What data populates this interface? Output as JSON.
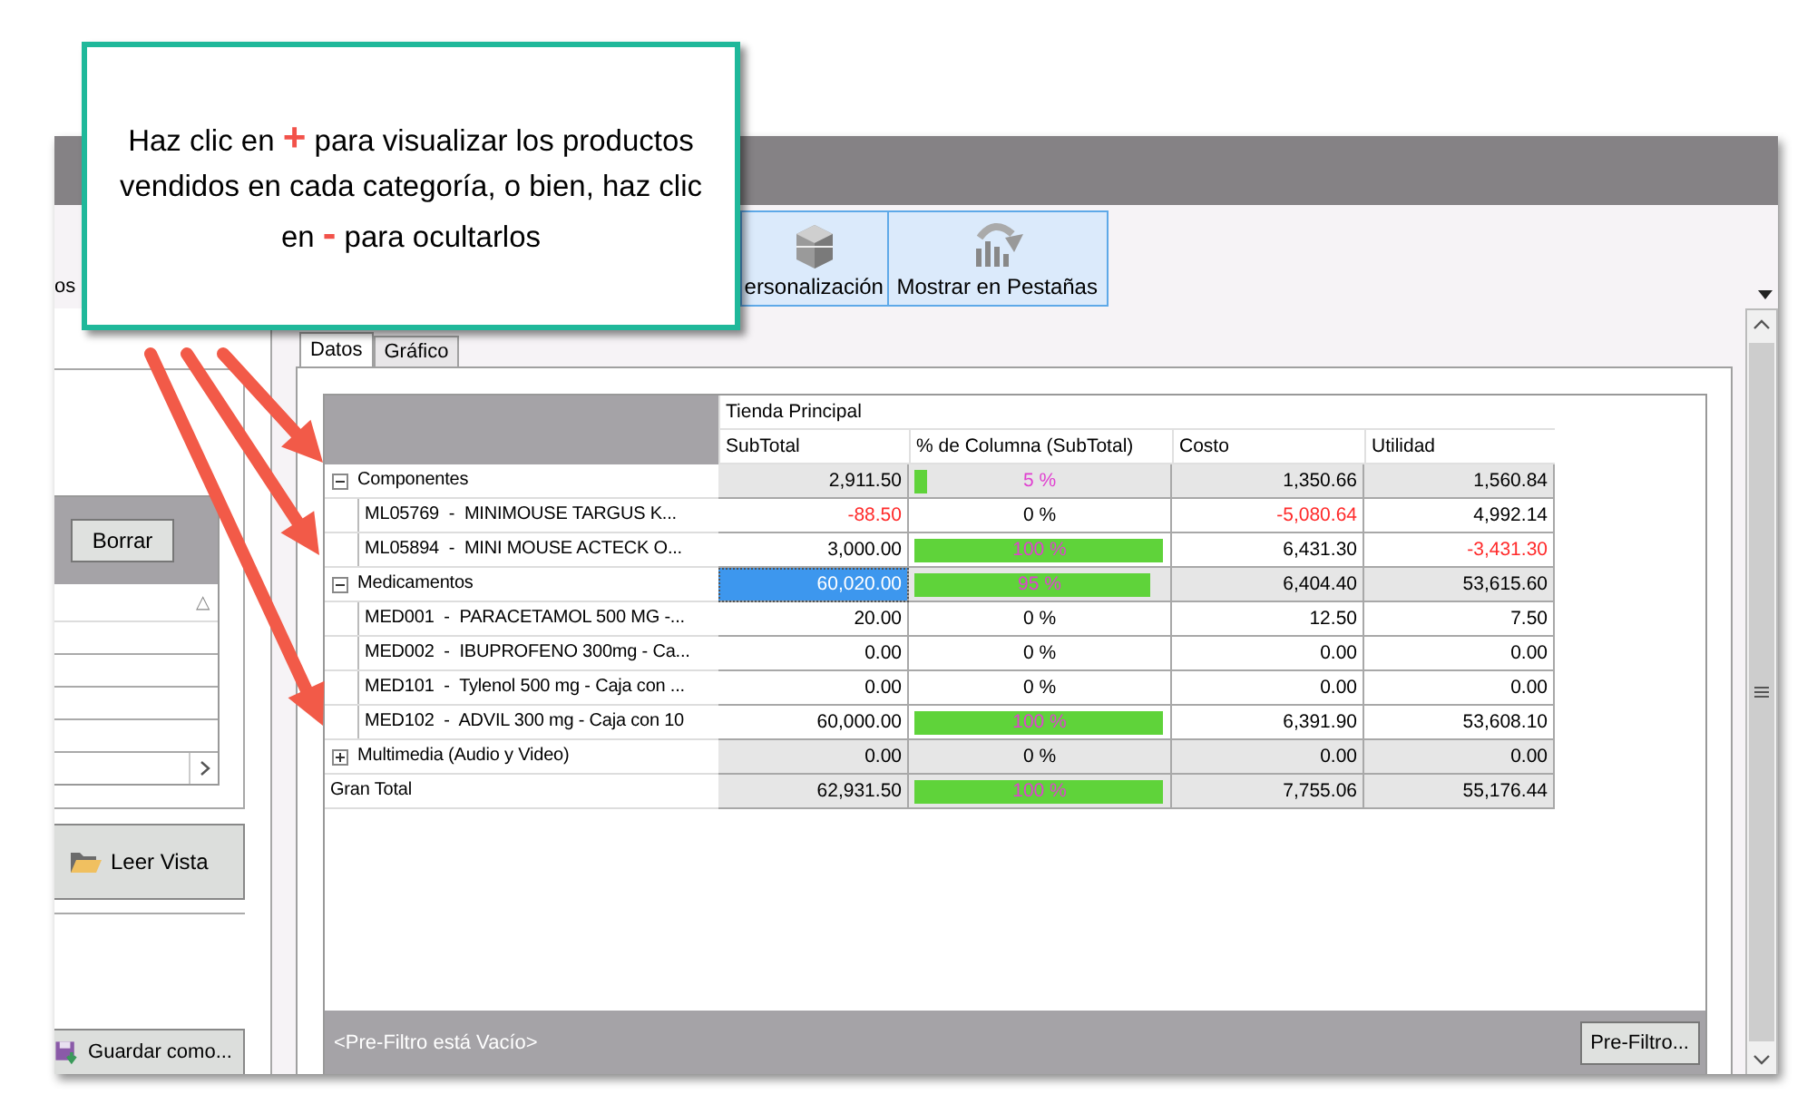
{
  "callout": {
    "parts": [
      {
        "kind": "text",
        "text": "Haz clic en "
      },
      {
        "kind": "symbol",
        "text": "+"
      },
      {
        "kind": "text",
        "text": " para visualizar los productos vendidos en cada categoría, o bien, haz clic en "
      },
      {
        "kind": "symbol",
        "text": "-"
      },
      {
        "kind": "text",
        "text": " para ocultarlos"
      }
    ]
  },
  "toolbar": {
    "cut_label": "os",
    "buttons": [
      {
        "label": "ersonalización"
      },
      {
        "label": "Mostrar en Pestañas"
      }
    ]
  },
  "left_panel": {
    "clear_button": "Borrar",
    "sort_glyph": "△",
    "load_button": "Leer Vista",
    "save_button": "Guardar como..."
  },
  "tabs": [
    {
      "label": "Datos",
      "selected": true
    },
    {
      "label": "Gráfico",
      "selected": false
    }
  ],
  "pivot": {
    "group_header": "Tienda Principal",
    "columns": [
      "SubTotal",
      "% de Columna (SubTotal)",
      "Costo",
      "Utilidad"
    ],
    "rows": [
      {
        "kind": "category",
        "label": "Componentes",
        "expanded": true,
        "subtotal": {
          "text": "2,911.50",
          "negative": false,
          "selected": false
        },
        "share": {
          "text": "5 %",
          "level": 0.05
        },
        "costo": {
          "text": "1,350.66",
          "negative": false
        },
        "utilidad": {
          "text": "1,560.84",
          "negative": false
        }
      },
      {
        "kind": "item",
        "label": "ML05769  -  MINIMOUSE TARGUS K...",
        "subtotal": {
          "text": "-88.50",
          "negative": true,
          "selected": false
        },
        "share": {
          "text": "0 %"
        },
        "costo": {
          "text": "-5,080.64",
          "negative": true
        },
        "utilidad": {
          "text": "4,992.14",
          "negative": false
        }
      },
      {
        "kind": "item",
        "label": "ML05894  -  MINI MOUSE ACTECK O...",
        "subtotal": {
          "text": "3,000.00",
          "negative": false,
          "selected": false
        },
        "share": {
          "text": "100 %",
          "level": 1
        },
        "costo": {
          "text": "6,431.30",
          "negative": false
        },
        "utilidad": {
          "text": "-3,431.30",
          "negative": true
        }
      },
      {
        "kind": "category",
        "label": "Medicamentos",
        "expanded": true,
        "subtotal": {
          "text": "60,020.00",
          "negative": false,
          "selected": true
        },
        "share": {
          "text": "95 %",
          "level": 0.95
        },
        "costo": {
          "text": "6,404.40",
          "negative": false
        },
        "utilidad": {
          "text": "53,615.60",
          "negative": false
        }
      },
      {
        "kind": "item",
        "label": "MED001  -  PARACETAMOL 500 MG -...",
        "subtotal": {
          "text": "20.00",
          "negative": false,
          "selected": false
        },
        "share": {
          "text": "0 %"
        },
        "costo": {
          "text": "12.50",
          "negative": false
        },
        "utilidad": {
          "text": "7.50",
          "negative": false
        }
      },
      {
        "kind": "item",
        "label": "MED002  -  IBUPROFENO 300mg - Ca...",
        "subtotal": {
          "text": "0.00",
          "negative": false,
          "selected": false
        },
        "share": {
          "text": "0 %"
        },
        "costo": {
          "text": "0.00",
          "negative": false
        },
        "utilidad": {
          "text": "0.00",
          "negative": false
        }
      },
      {
        "kind": "item",
        "label": "MED101  -  Tylenol 500 mg - Caja con ...",
        "subtotal": {
          "text": "0.00",
          "negative": false,
          "selected": false
        },
        "share": {
          "text": "0 %"
        },
        "costo": {
          "text": "0.00",
          "negative": false
        },
        "utilidad": {
          "text": "0.00",
          "negative": false
        }
      },
      {
        "kind": "item",
        "label": "MED102  -  ADVIL 300 mg - Caja con 10",
        "subtotal": {
          "text": "60,000.00",
          "negative": false,
          "selected": false
        },
        "share": {
          "text": "100 %",
          "level": 1
        },
        "costo": {
          "text": "6,391.90",
          "negative": false
        },
        "utilidad": {
          "text": "53,608.10",
          "negative": false
        }
      },
      {
        "kind": "category",
        "label": "Multimedia (Audio y Video)",
        "expanded": false,
        "subtotal": {
          "text": "0.00",
          "negative": false,
          "selected": false
        },
        "share": {
          "text": "0 %"
        },
        "costo": {
          "text": "0.00",
          "negative": false
        },
        "utilidad": {
          "text": "0.00",
          "negative": false
        }
      },
      {
        "kind": "total",
        "label": "Gran Total",
        "subtotal": {
          "text": "62,931.50",
          "negative": false,
          "selected": false
        },
        "share": {
          "text": "100 %",
          "level": 1
        },
        "costo": {
          "text": "7,755.06",
          "negative": false
        },
        "utilidad": {
          "text": "55,176.44",
          "negative": false
        }
      }
    ]
  },
  "filter_bar": {
    "status": "<Pre-Filtro está Vacío>",
    "button": "Pre-Filtro..."
  }
}
